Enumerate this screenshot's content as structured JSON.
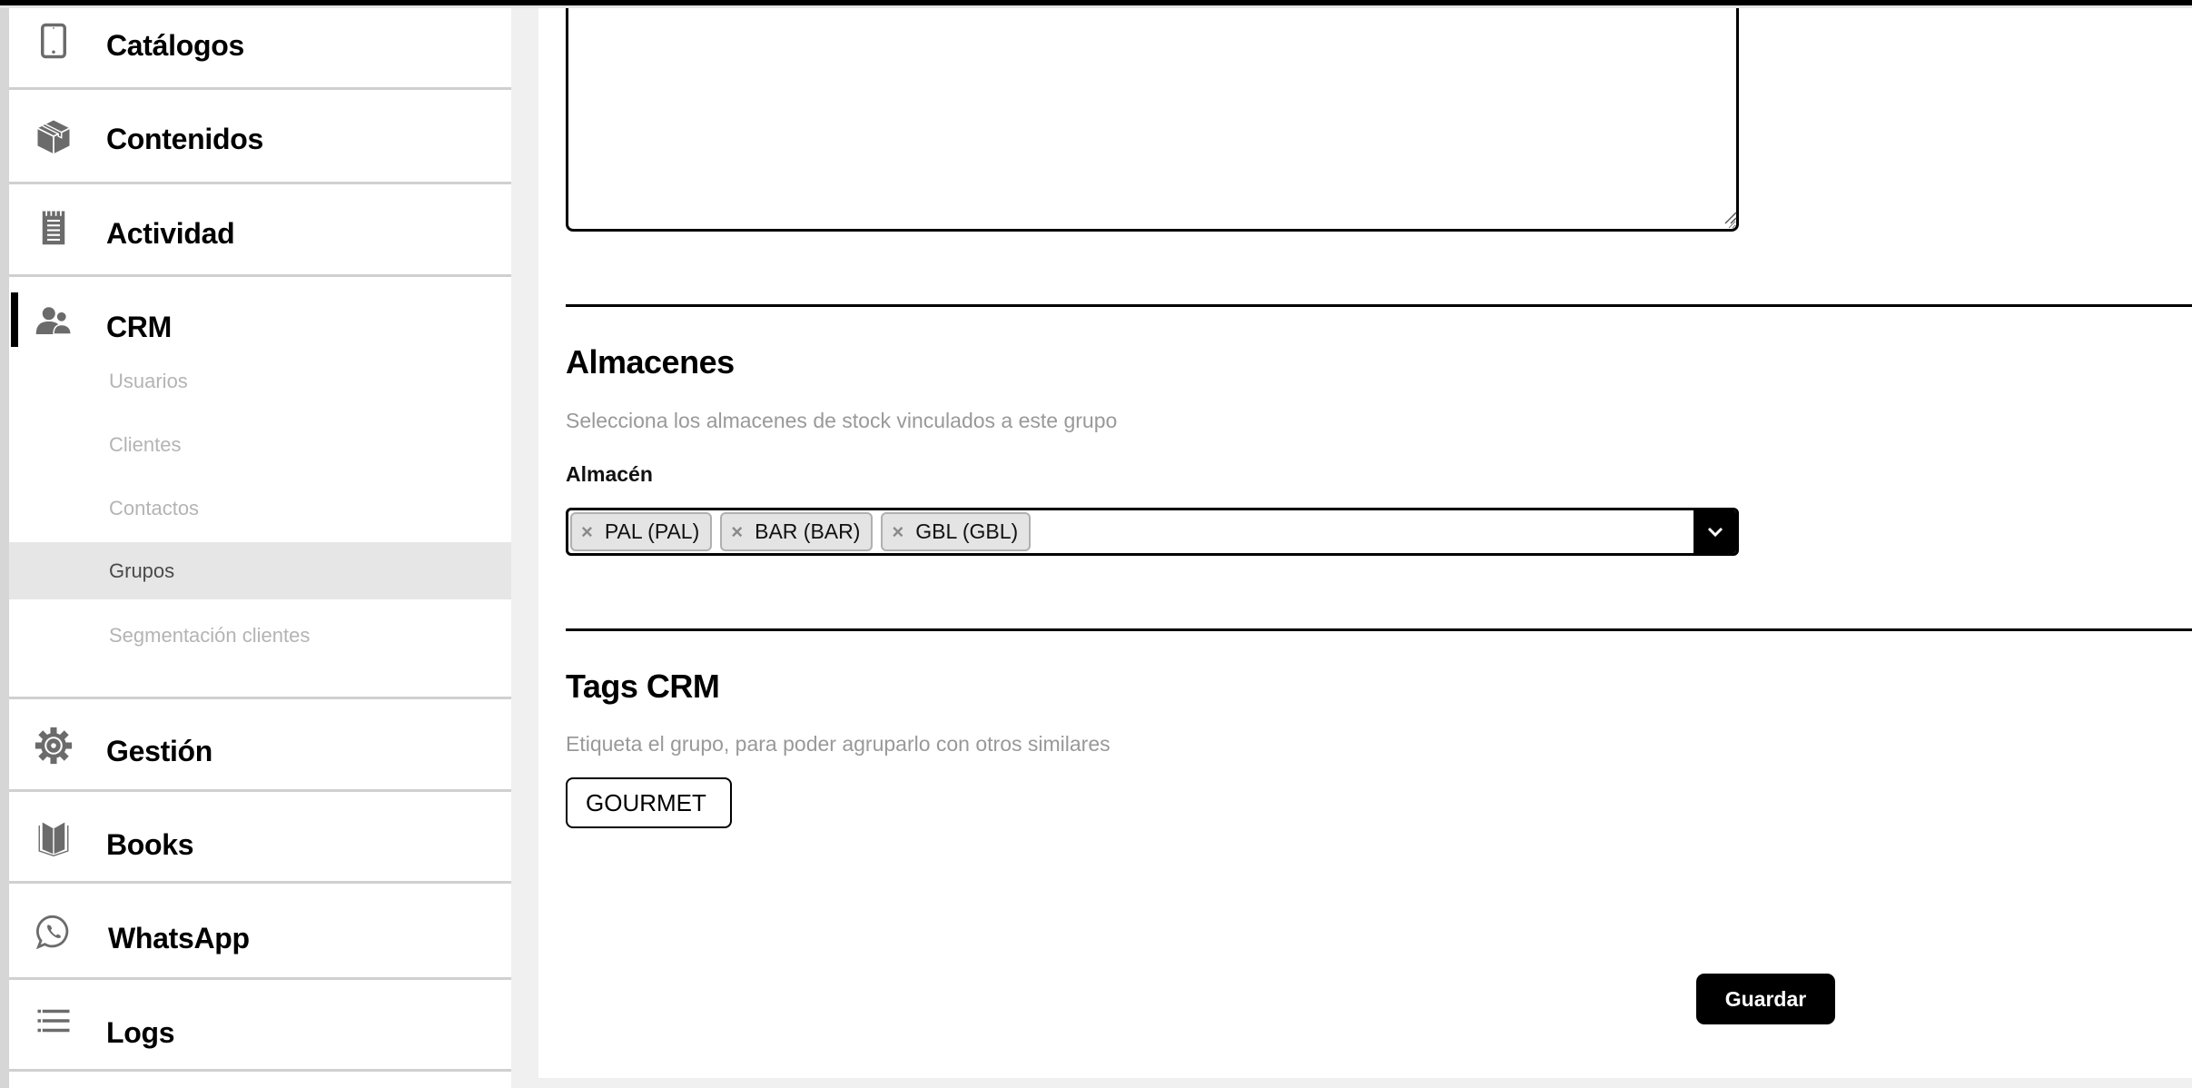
{
  "sidebar": {
    "items": [
      {
        "label": "Catálogos",
        "icon": "tablet-icon"
      },
      {
        "label": "Contenidos",
        "icon": "box-icon"
      },
      {
        "label": "Actividad",
        "icon": "notepad-icon"
      },
      {
        "label": "CRM",
        "icon": "users-icon",
        "active": true
      },
      {
        "label": "Gestión",
        "icon": "gear-icon"
      },
      {
        "label": "Books",
        "icon": "book-icon"
      },
      {
        "label": "WhatsApp",
        "icon": "whatsapp-icon"
      },
      {
        "label": "Logs",
        "icon": "list-icon"
      }
    ],
    "crm_subitems": [
      {
        "label": "Usuarios"
      },
      {
        "label": "Clientes"
      },
      {
        "label": "Contactos"
      },
      {
        "label": "Grupos",
        "active": true
      },
      {
        "label": "Segmentación clientes"
      }
    ]
  },
  "main": {
    "textarea": {
      "value": ""
    },
    "almacenes": {
      "title": "Almacenes",
      "description": "Selecciona los almacenes de stock vinculados a este grupo",
      "field_label": "Almacén",
      "selected": [
        {
          "label": "PAL (PAL)"
        },
        {
          "label": "BAR (BAR)"
        },
        {
          "label": "GBL (GBL)"
        }
      ],
      "remove_glyph": "×"
    },
    "tags": {
      "title": "Tags CRM",
      "description": "Etiqueta el grupo, para poder agruparlo con otros similares",
      "items": [
        {
          "label": "GOURMET"
        }
      ]
    },
    "save_label": "Guardar"
  },
  "colors": {
    "accent": "#000000",
    "muted_text": "#999999",
    "sidebar_active_bg": "#e6e6e6",
    "icon_gray": "#6b6b6b"
  }
}
